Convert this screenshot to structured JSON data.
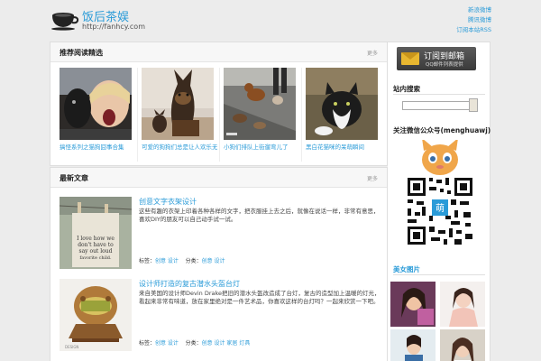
{
  "header": {
    "site_title": "饭后茶娱",
    "site_url": "http://fanhcy.com",
    "links": [
      "新浪微博",
      "腾讯微博",
      "订阅本站RSS"
    ],
    "logo_icon": "teacup-icon"
  },
  "recommend": {
    "title": "推荐阅读精选",
    "more": "更多",
    "items": [
      {
        "caption": "搞怪系列之猫狗囧事合集"
      },
      {
        "caption": "可爱的狗狗们总是让人欢乐无比"
      },
      {
        "caption": "小狗们排队上街遛弯儿了"
      },
      {
        "caption": "黑白花猫咪的呆萌瞬间"
      }
    ]
  },
  "latest": {
    "title": "最新文章",
    "more": "更多",
    "articles": [
      {
        "title": "创意文字衣架设计",
        "summary": "这些有趣的衣架上印着各种各样的文字，把衣服挂上去之后，就像在说话一样，非常有意思，喜欢DIY的朋友可以自己动手试一试。",
        "meta_tag_label": "标签：",
        "meta_tags": "创意 设计",
        "meta_cat_label": "分类：",
        "meta_cat": "创意 设计"
      },
      {
        "title": "设计师打造的复古潜水头盔台灯",
        "summary": "来自美国的设计师Devin Drake把旧的潜水头盔改造成了台灯，复古的造型加上温暖的灯光，看起来非常有味道，放在家里绝对是一件艺术品，你喜欢这样的台灯吗？一起来欣赏一下吧。",
        "meta_tag_label": "标签：",
        "meta_tags": "创意 设计",
        "meta_cat_label": "分类：",
        "meta_cat": "创意 设计 家居 灯具"
      }
    ]
  },
  "sidebar": {
    "subscribe_main": "订阅到邮箱",
    "subscribe_sub": "QQ邮件列表提供",
    "search_title": "站内搜索",
    "wechat_title": "关注微信公众号(menghuawj)",
    "girls_title": "美女图片"
  },
  "colors": {
    "link": "#2a9bd8",
    "background": "#ececec"
  }
}
